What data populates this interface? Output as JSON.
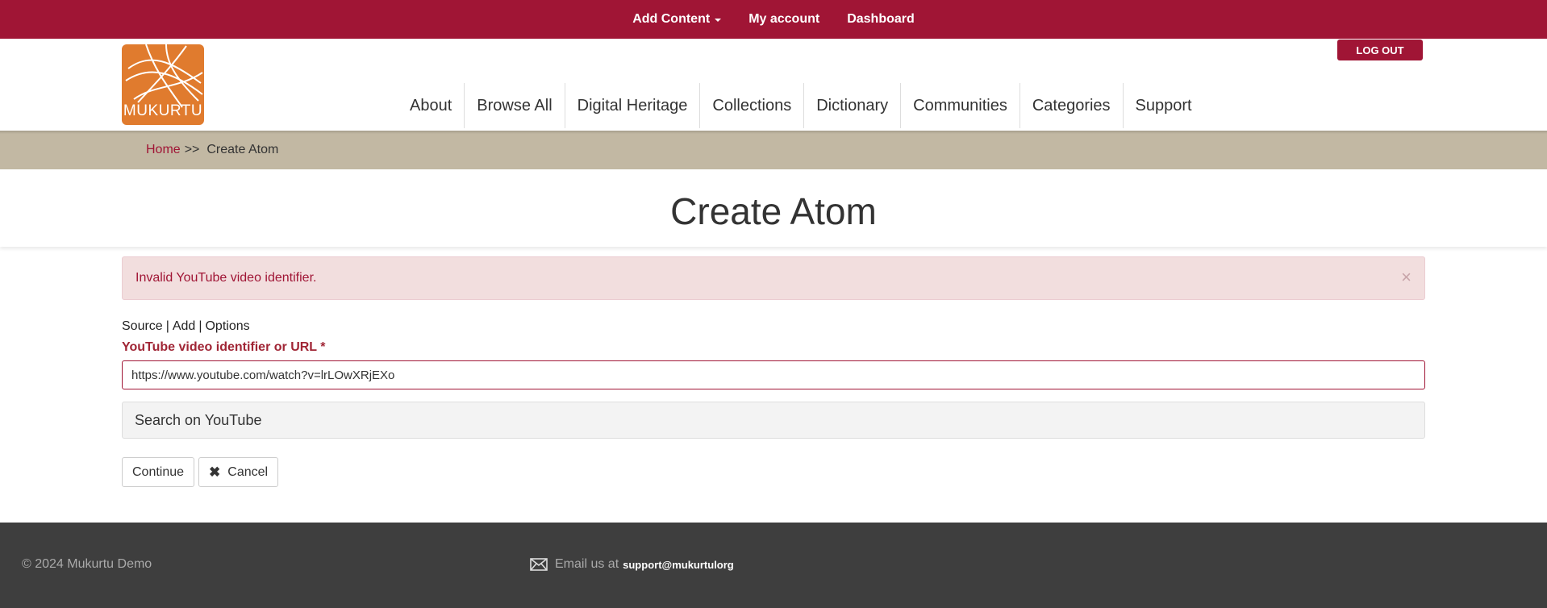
{
  "admin_bar": {
    "add_content": "Add Content",
    "my_account": "My account",
    "dashboard": "Dashboard",
    "bg_color": "#a01535"
  },
  "header": {
    "logo_text": "MUKURTU",
    "logout_label": "LOG OUT",
    "nav": [
      "About",
      "Browse All",
      "Digital Heritage",
      "Collections",
      "Dictionary",
      "Communities",
      "Categories",
      "Support"
    ]
  },
  "breadcrumb": {
    "home": "Home",
    "separator": ">>",
    "current": "Create Atom"
  },
  "page": {
    "title": "Create Atom"
  },
  "alert": {
    "message": "Invalid YouTube video identifier.",
    "close": "×"
  },
  "steps": {
    "source": "Source",
    "add": "Add",
    "options": "Options",
    "divider": "|"
  },
  "form": {
    "field_label": "YouTube video identifier or URL *",
    "field_value": "https://www.youtube.com/watch?v=lrLOwXRjEXo",
    "search_panel": "Search on YouTube",
    "continue_label": "Continue",
    "cancel_label": "Cancel",
    "cancel_icon": "✖"
  },
  "footer": {
    "copyright": "© 2024 Mukurtu Demo",
    "email_prefix": "Email us at",
    "email_address": "support@mukurtulorg"
  },
  "colors": {
    "brand": "#a01535",
    "logo": "#e07b2e",
    "breadcrumb_bg": "#c2b8a3",
    "footer_bg": "#3e3e3e"
  }
}
